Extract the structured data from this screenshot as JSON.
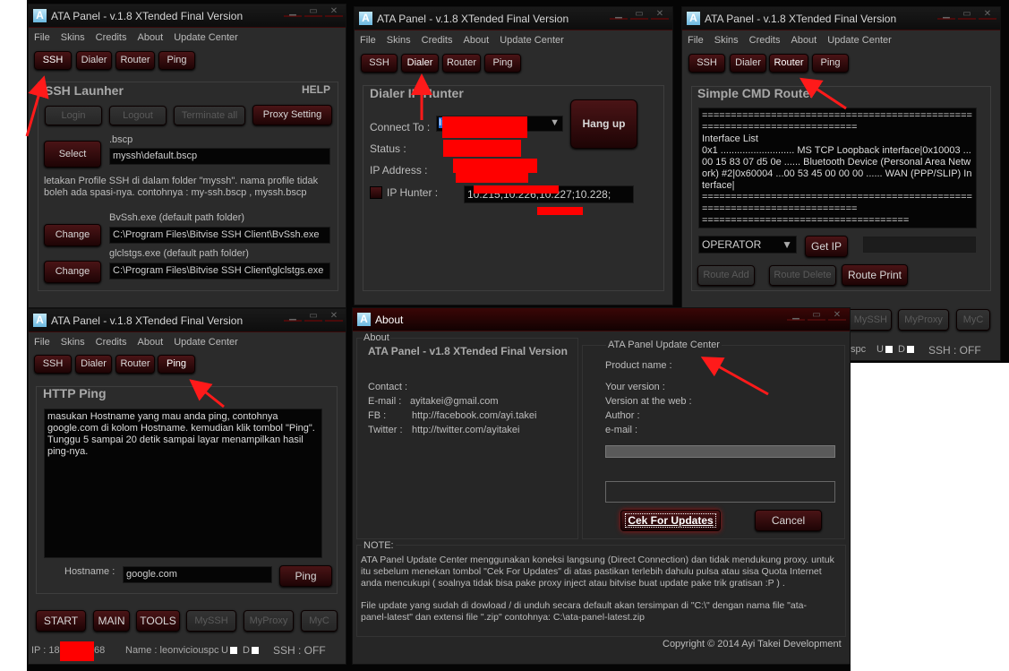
{
  "app": {
    "title": "ATA Panel - v.1.8 XTended Final Version",
    "logo": "A",
    "menu": [
      "File",
      "Skins",
      "Credits",
      "About",
      "Update Center"
    ],
    "tabs": [
      "SSH",
      "Dialer",
      "Router",
      "Ping"
    ],
    "window_controls": {
      "minimize": "▁",
      "maximize": "▭",
      "close": "✕"
    },
    "bottom_buttons": [
      "START",
      "MAIN",
      "TOOLS",
      "MySSH",
      "MyProxy",
      "MyC"
    ],
    "status": {
      "ip_label": "IP : 182",
      "ip_suffix": "68",
      "name": "Name : leonviciouspc",
      "name_partial": "spc",
      "u": "U",
      "d": "D",
      "ssh": "SSH : OFF"
    }
  },
  "ssh": {
    "heading": "SSH Launher",
    "help": "HELP",
    "login": "Login",
    "logout": "Logout",
    "terminate": "Terminate all",
    "proxy": "Proxy Setting",
    "select": "Select",
    "bscp_label": ".bscp",
    "bscp_value": "myssh\\default.bscp",
    "note": "letakan Profile SSH di dalam folder \"myssh\". nama profile tidak boleh ada spasi-nya. contohnya : my-ssh.bscp , myssh.bscp",
    "bvssh_label": "BvSsh.exe (default path folder)",
    "bvssh_value": "C:\\Program Files\\Bitvise SSH Client\\BvSsh.exe",
    "glc_label": "glclstgs.exe (default path folder)",
    "glc_value": "C:\\Program Files\\Bitvise SSH Client\\glclstgs.exe",
    "change": "Change"
  },
  "dialer": {
    "heading": "Dialer IP Hunter",
    "connect_label": "Connect To :",
    "connect_value": "In",
    "hangup": "Hang up",
    "status_label": "Status :",
    "ip_label": "IP Address :",
    "hunter_label": "IP Hunter :",
    "hunter_value": "10.215;10.226;10.227;10.228;"
  },
  "router": {
    "heading": "Simple CMD Router",
    "console": "==========================================================================\nInterface List\n0x1 ........................... MS TCP Loopback interface|0x10003 ...00 15 83 07 d5 0e ...... Bluetooth Device (Personal Area Network) #2|0x60004 ...00 53 45 00 00 00 ...... WAN (PPP/SLIP) Interface|\n==========================================================================\n====================================",
    "operator": "OPERATOR",
    "getip": "Get IP",
    "route_add": "Route Add",
    "route_delete": "Route Delete",
    "route_print": "Route Print"
  },
  "ping": {
    "heading": "HTTP Ping",
    "output": "masukan Hostname yang mau anda ping, contohnya google.com di kolom Hostname. kemudian klik tombol \"Ping\". Tunggu 5 sampai 20 detik sampai layar menampilkan hasil ping-nya.",
    "host_label": "Hostname :",
    "host_value": "google.com",
    "ping_button": "Ping"
  },
  "about": {
    "title": "About",
    "group": "About",
    "product": "ATA Panel - v1.8 XTended Final Version",
    "contact": "Contact :",
    "email_label": "E-mail :",
    "email": "ayitakei@gmail.com",
    "fb_label": "FB :",
    "fb": "http://facebook.com/ayi.takei",
    "tw_label": "Twitter :",
    "tw": "http://twitter.com/ayitakei",
    "update_group": "ATA Panel Update Center",
    "product_name": "Product name :",
    "your_version": "Your version :",
    "web_version": "Version at the web :",
    "author": "Author :",
    "umail": "e-mail :",
    "progress": 0,
    "check": "Cek For Updates",
    "cancel": "Cancel",
    "note_label": "NOTE:",
    "note1": "ATA Panel Update Center menggunakan koneksi langsung (Direct Connection)  dan tidak mendukung proxy. untuk itu sebelum menekan tombol \"Cek For Updates\" di atas pastikan terlebih dahulu pulsa atau sisa Quota Internet anda mencukupi  ( soalnya tidak bisa pake proxy inject atau  bitvise buat update pake trik gratisan :P ) .",
    "note2": "File update yang sudah di dowload / di unduh secara default akan tersimpan di \"C:\\\" dengan  nama file \"ata-panel-latest\" dan extensi file \".zip\" contohnya: C:\\ata-panel-latest.zip",
    "copyright": "Copyright © 2014 Ayi Takei Development"
  },
  "colors": {
    "annotation": "#ff1a1a",
    "button": "#4a1416",
    "window": "#2b2b2b"
  }
}
